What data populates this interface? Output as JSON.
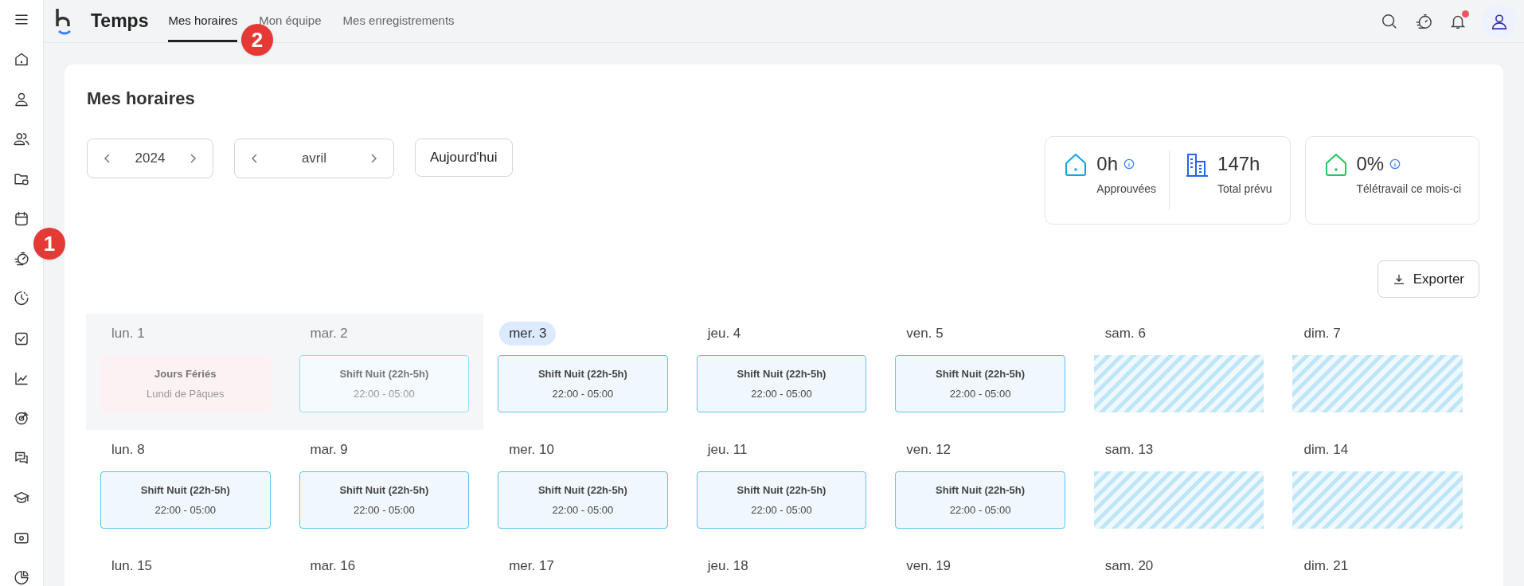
{
  "app": {
    "title": "Temps"
  },
  "tabs": [
    {
      "label": "Mes horaires",
      "selected": true
    },
    {
      "label": "Mon équipe",
      "selected": false
    },
    {
      "label": "Mes enregistrements",
      "selected": false
    }
  ],
  "notifications": {
    "unread": true
  },
  "page": {
    "title": "Mes horaires"
  },
  "year_picker": {
    "value": "2024"
  },
  "month_picker": {
    "value": "avril"
  },
  "today_button": "Aujourd'hui",
  "stat_cards": [
    {
      "items": [
        {
          "kind": "house",
          "color": "#0ea5e9",
          "value": "0h",
          "label": "Approuvées",
          "info": true
        },
        {
          "kind": "building",
          "color": "#2563eb",
          "value": "147h",
          "label": "Total prévu",
          "info": false
        }
      ]
    },
    {
      "items": [
        {
          "kind": "house",
          "color": "#22c55e",
          "value": "0%",
          "label": "Télétravail ce mois-ci",
          "info": true
        }
      ]
    }
  ],
  "export_button": "Exporter",
  "weeks": [
    {
      "days": [
        {
          "label": "lun. 1",
          "past": true,
          "today": false,
          "entry": {
            "kind": "holiday",
            "title": "Jours Fériés",
            "subtitle": "Lundi de Pâques"
          }
        },
        {
          "label": "mar. 2",
          "past": true,
          "today": false,
          "entry": {
            "kind": "shift",
            "title": "Shift Nuit (22h-5h)",
            "subtitle": "22:00 - 05:00"
          }
        },
        {
          "label": "mer. 3",
          "past": false,
          "today": true,
          "entry": {
            "kind": "shift",
            "title": "Shift Nuit (22h-5h)",
            "subtitle": "22:00 - 05:00"
          }
        },
        {
          "label": "jeu. 4",
          "past": false,
          "today": false,
          "entry": {
            "kind": "shift",
            "title": "Shift Nuit (22h-5h)",
            "subtitle": "22:00 - 05:00"
          }
        },
        {
          "label": "ven. 5",
          "past": false,
          "today": false,
          "entry": {
            "kind": "shift",
            "title": "Shift Nuit (22h-5h)",
            "subtitle": "22:00 - 05:00"
          }
        },
        {
          "label": "sam. 6",
          "past": false,
          "today": false,
          "entry": {
            "kind": "off"
          }
        },
        {
          "label": "dim. 7",
          "past": false,
          "today": false,
          "entry": {
            "kind": "off"
          }
        }
      ]
    },
    {
      "days": [
        {
          "label": "lun. 8",
          "past": false,
          "today": false,
          "entry": {
            "kind": "shift",
            "title": "Shift Nuit (22h-5h)",
            "subtitle": "22:00 - 05:00"
          }
        },
        {
          "label": "mar. 9",
          "past": false,
          "today": false,
          "entry": {
            "kind": "shift",
            "title": "Shift Nuit (22h-5h)",
            "subtitle": "22:00 - 05:00"
          }
        },
        {
          "label": "mer. 10",
          "past": false,
          "today": false,
          "entry": {
            "kind": "shift",
            "title": "Shift Nuit (22h-5h)",
            "subtitle": "22:00 - 05:00"
          }
        },
        {
          "label": "jeu. 11",
          "past": false,
          "today": false,
          "entry": {
            "kind": "shift",
            "title": "Shift Nuit (22h-5h)",
            "subtitle": "22:00 - 05:00"
          }
        },
        {
          "label": "ven. 12",
          "past": false,
          "today": false,
          "entry": {
            "kind": "shift",
            "title": "Shift Nuit (22h-5h)",
            "subtitle": "22:00 - 05:00"
          }
        },
        {
          "label": "sam. 13",
          "past": false,
          "today": false,
          "entry": {
            "kind": "off"
          }
        },
        {
          "label": "dim. 14",
          "past": false,
          "today": false,
          "entry": {
            "kind": "off"
          }
        }
      ]
    },
    {
      "days": [
        {
          "label": "lun. 15",
          "past": false,
          "today": false
        },
        {
          "label": "mar. 16",
          "past": false,
          "today": false
        },
        {
          "label": "mer. 17",
          "past": false,
          "today": false
        },
        {
          "label": "jeu. 18",
          "past": false,
          "today": false
        },
        {
          "label": "ven. 19",
          "past": false,
          "today": false
        },
        {
          "label": "sam. 20",
          "past": false,
          "today": false
        },
        {
          "label": "dim. 21",
          "past": false,
          "today": false
        }
      ]
    }
  ],
  "annotations": [
    "1",
    "2"
  ]
}
